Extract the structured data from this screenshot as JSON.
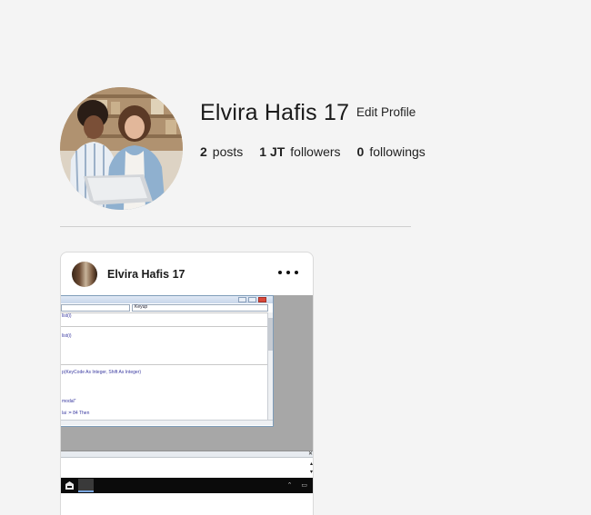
{
  "profile": {
    "name": "Elvira Hafis 17",
    "edit_label": "Edit Profile",
    "stats": [
      {
        "value": "2",
        "label": "posts"
      },
      {
        "value": "1 JT",
        "label": "followers"
      },
      {
        "value": "0",
        "label": "followings"
      }
    ]
  },
  "post": {
    "author": "Elvira Hafis 17",
    "more_icon": "more-horizontal-icon",
    "image": {
      "combo_right": "Keyup",
      "code_lines": [
        "list(i)",
        "list(i)",
        "p(KeyCode As Integer, Shift As Integer)",
        "modal\"",
        "lai := 84 Then"
      ]
    }
  },
  "colors": {
    "page_background": "#f4f4f4",
    "card_background": "#ffffff",
    "divider": "#cfcfcf",
    "text": "#1a1a1a"
  }
}
